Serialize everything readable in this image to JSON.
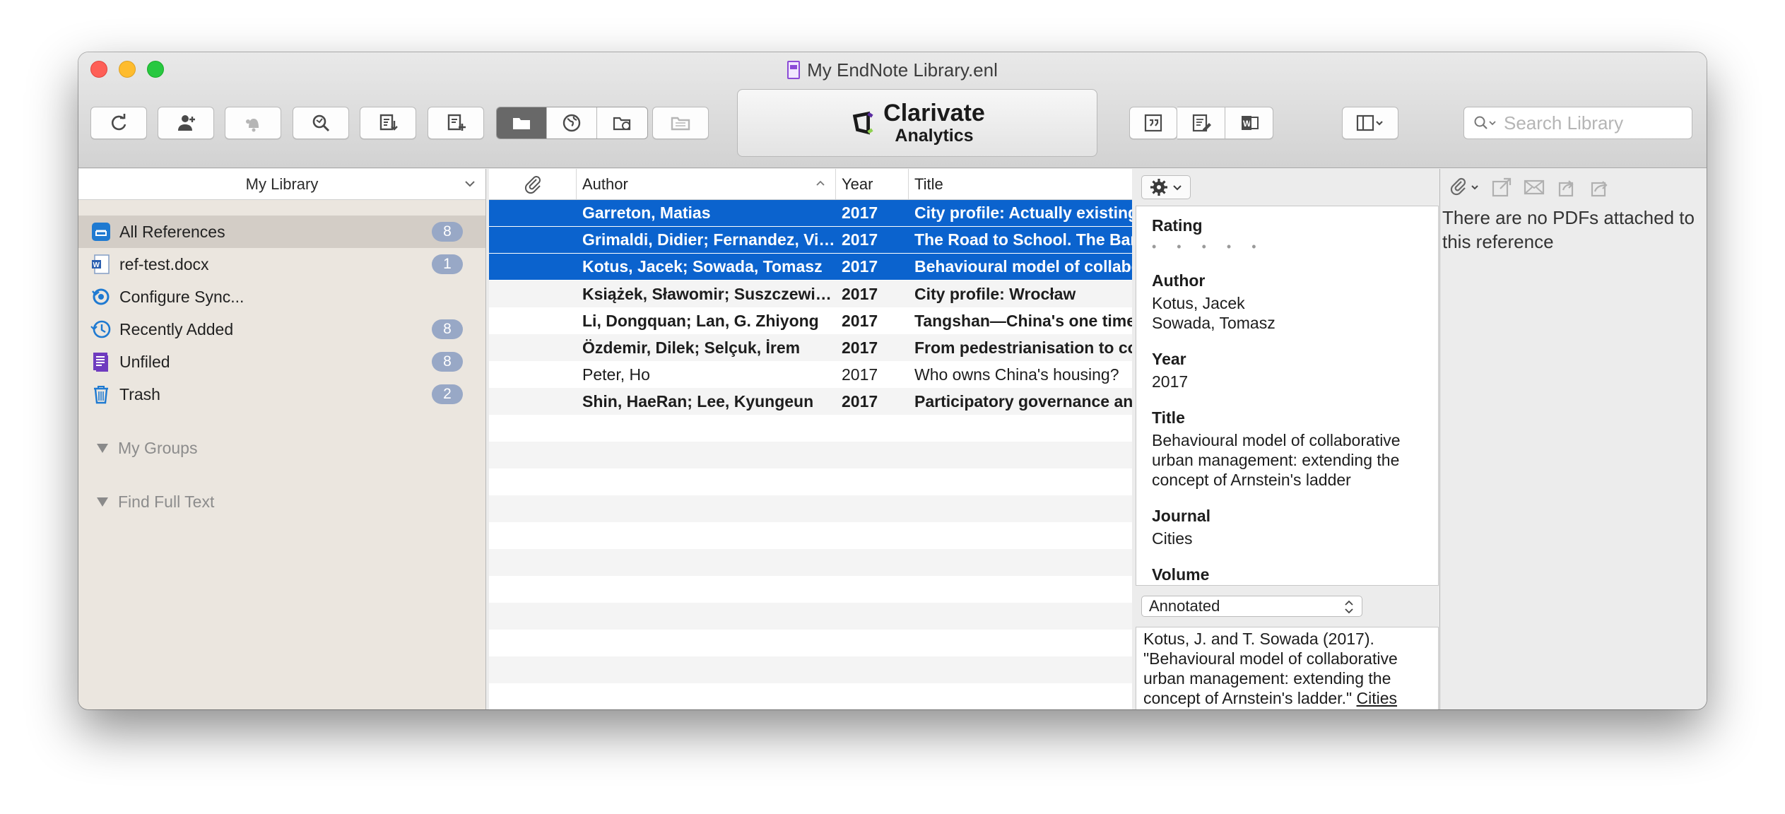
{
  "window": {
    "title": "My EndNote Library.enl"
  },
  "brand": {
    "name": "Clarivate",
    "sub": "Analytics"
  },
  "search": {
    "placeholder": "Search Library"
  },
  "sidebar": {
    "header": "My Library",
    "items": [
      {
        "label": "All References",
        "count": "8"
      },
      {
        "label": "ref-test.docx",
        "count": "1"
      },
      {
        "label": "Configure Sync...",
        "count": ""
      },
      {
        "label": "Recently Added",
        "count": "8"
      },
      {
        "label": "Unfiled",
        "count": "8"
      },
      {
        "label": "Trash",
        "count": "2"
      }
    ],
    "groups": [
      "My Groups",
      "Find Full Text"
    ]
  },
  "refs": {
    "columns": {
      "author": "Author",
      "year": "Year",
      "title": "Title"
    },
    "rows": [
      {
        "author": "Garreton, Matias",
        "year": "2017",
        "title": "City profile: Actually existing"
      },
      {
        "author": "Grimaldi, Didier; Fernandez, Vicenç",
        "year": "2017",
        "title": "The Road to School. The Barcelona"
      },
      {
        "author": "Kotus, Jacek; Sowada, Tomasz",
        "year": "2017",
        "title": "Behavioural model of collaborative"
      },
      {
        "author": "Książek, Sławomir; Suszczewicz, M",
        "year": "2017",
        "title": "City profile: Wrocław"
      },
      {
        "author": "Li, Dongquan; Lan, G. Zhiyong",
        "year": "2017",
        "title": "Tangshan—China's one time"
      },
      {
        "author": "Özdemir, Dilek; Selçuk, İrem",
        "year": "2017",
        "title": "From pedestrianisation to commercial"
      },
      {
        "author": "Peter, Ho",
        "year": "2017",
        "title": "Who owns China's housing?"
      },
      {
        "author": "Shin, HaeRan; Lee, Kyungeun",
        "year": "2017",
        "title": "Participatory governance and"
      }
    ]
  },
  "preview": {
    "rating_label": "Rating",
    "rating_dots": "• • • • •",
    "author_label": "Author",
    "author_1": "Kotus, Jacek",
    "author_2": "Sowada, Tomasz",
    "year_label": "Year",
    "year": "2017",
    "title_label": "Title",
    "title": "Behavioural model of collaborative urban management: extending the concept of Arnstein's ladder",
    "journal_label": "Journal",
    "journal": "Cities",
    "volume_label": "Volume",
    "style": "Annotated",
    "citation_text": "Kotus, J. and T. Sowada (2017). \"Behavioural model of collaborative urban management: extending the concept of Arnstein's ladder.\"",
    "citation_journal": "Cities"
  },
  "pdf": {
    "message": "There are no PDFs attached to this reference"
  },
  "colors": {
    "selection": "#0b63ce",
    "badge": "#98a8c6",
    "sidebar": "#ebe6df",
    "brand_purple": "#5a2ca0"
  }
}
